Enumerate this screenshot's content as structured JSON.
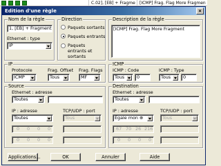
{
  "background_table": {
    "cells": [
      "C.02], [EB] + Fragments",
      "[ICMP]  Frag. Flag More Fragment"
    ]
  },
  "dialog": {
    "title": "Edition d'une règle",
    "close_glyph": "×",
    "rule_name": {
      "label": "Nom de la règle",
      "value": "1, [EB] + Fragments"
    },
    "ethernet_type": {
      "label": "Ethernet : type",
      "value": "IP"
    },
    "direction": {
      "label": "Direction",
      "options": [
        "Paquets sortants",
        "Paquets entrants",
        "Paquets entrants et sortants"
      ],
      "selected": 1
    },
    "description": {
      "label": "Description de la règle",
      "value": "[ICMP]  Frag. Flag More Fragment"
    },
    "ip": {
      "label": "IP",
      "protocol": {
        "label": "Protocole",
        "value": "ICMP"
      },
      "frag_offset": {
        "label": "Frag. Offset",
        "value": "Tous"
      },
      "frag_flags": {
        "label": "Frag. Flags",
        "value": "MF"
      }
    },
    "icmp": {
      "label": "ICMP",
      "code": {
        "label": "ICMP : Code",
        "select": "Tous",
        "value": "0"
      },
      "type": {
        "label": "ICMP : Type",
        "select": "Tous",
        "value": "0"
      }
    },
    "source": {
      "label": "Source",
      "eth_addr": {
        "label": "Ethernet : adresse",
        "select": "Toutes",
        "value": ""
      },
      "ip_addr": {
        "label": "IP : adresse",
        "select": "Toutes",
        "octets": [
          "0",
          "0",
          "0",
          "0"
        ],
        "mask": [
          "0",
          "0",
          "0",
          "0"
        ]
      },
      "port": {
        "label": "TCP/UDP : port",
        "select": "Tous"
      }
    },
    "destination": {
      "label": "Destination",
      "eth_addr": {
        "label": "Ethernet : adresse",
        "select": "Toutes",
        "value": ""
      },
      "ip_addr": {
        "label": "IP : adresse",
        "select": "Egale mon ⊕",
        "octets": [
          "67",
          "70",
          "26",
          "216"
        ],
        "mask": [
          "0",
          "0",
          "0",
          "0"
        ]
      },
      "port": {
        "label": "TCP/UDP : port",
        "select": "Tous"
      }
    },
    "buttons": {
      "applications": "Applications...",
      "ok": "OK",
      "cancel": "Annuler",
      "help": "Aide"
    }
  }
}
